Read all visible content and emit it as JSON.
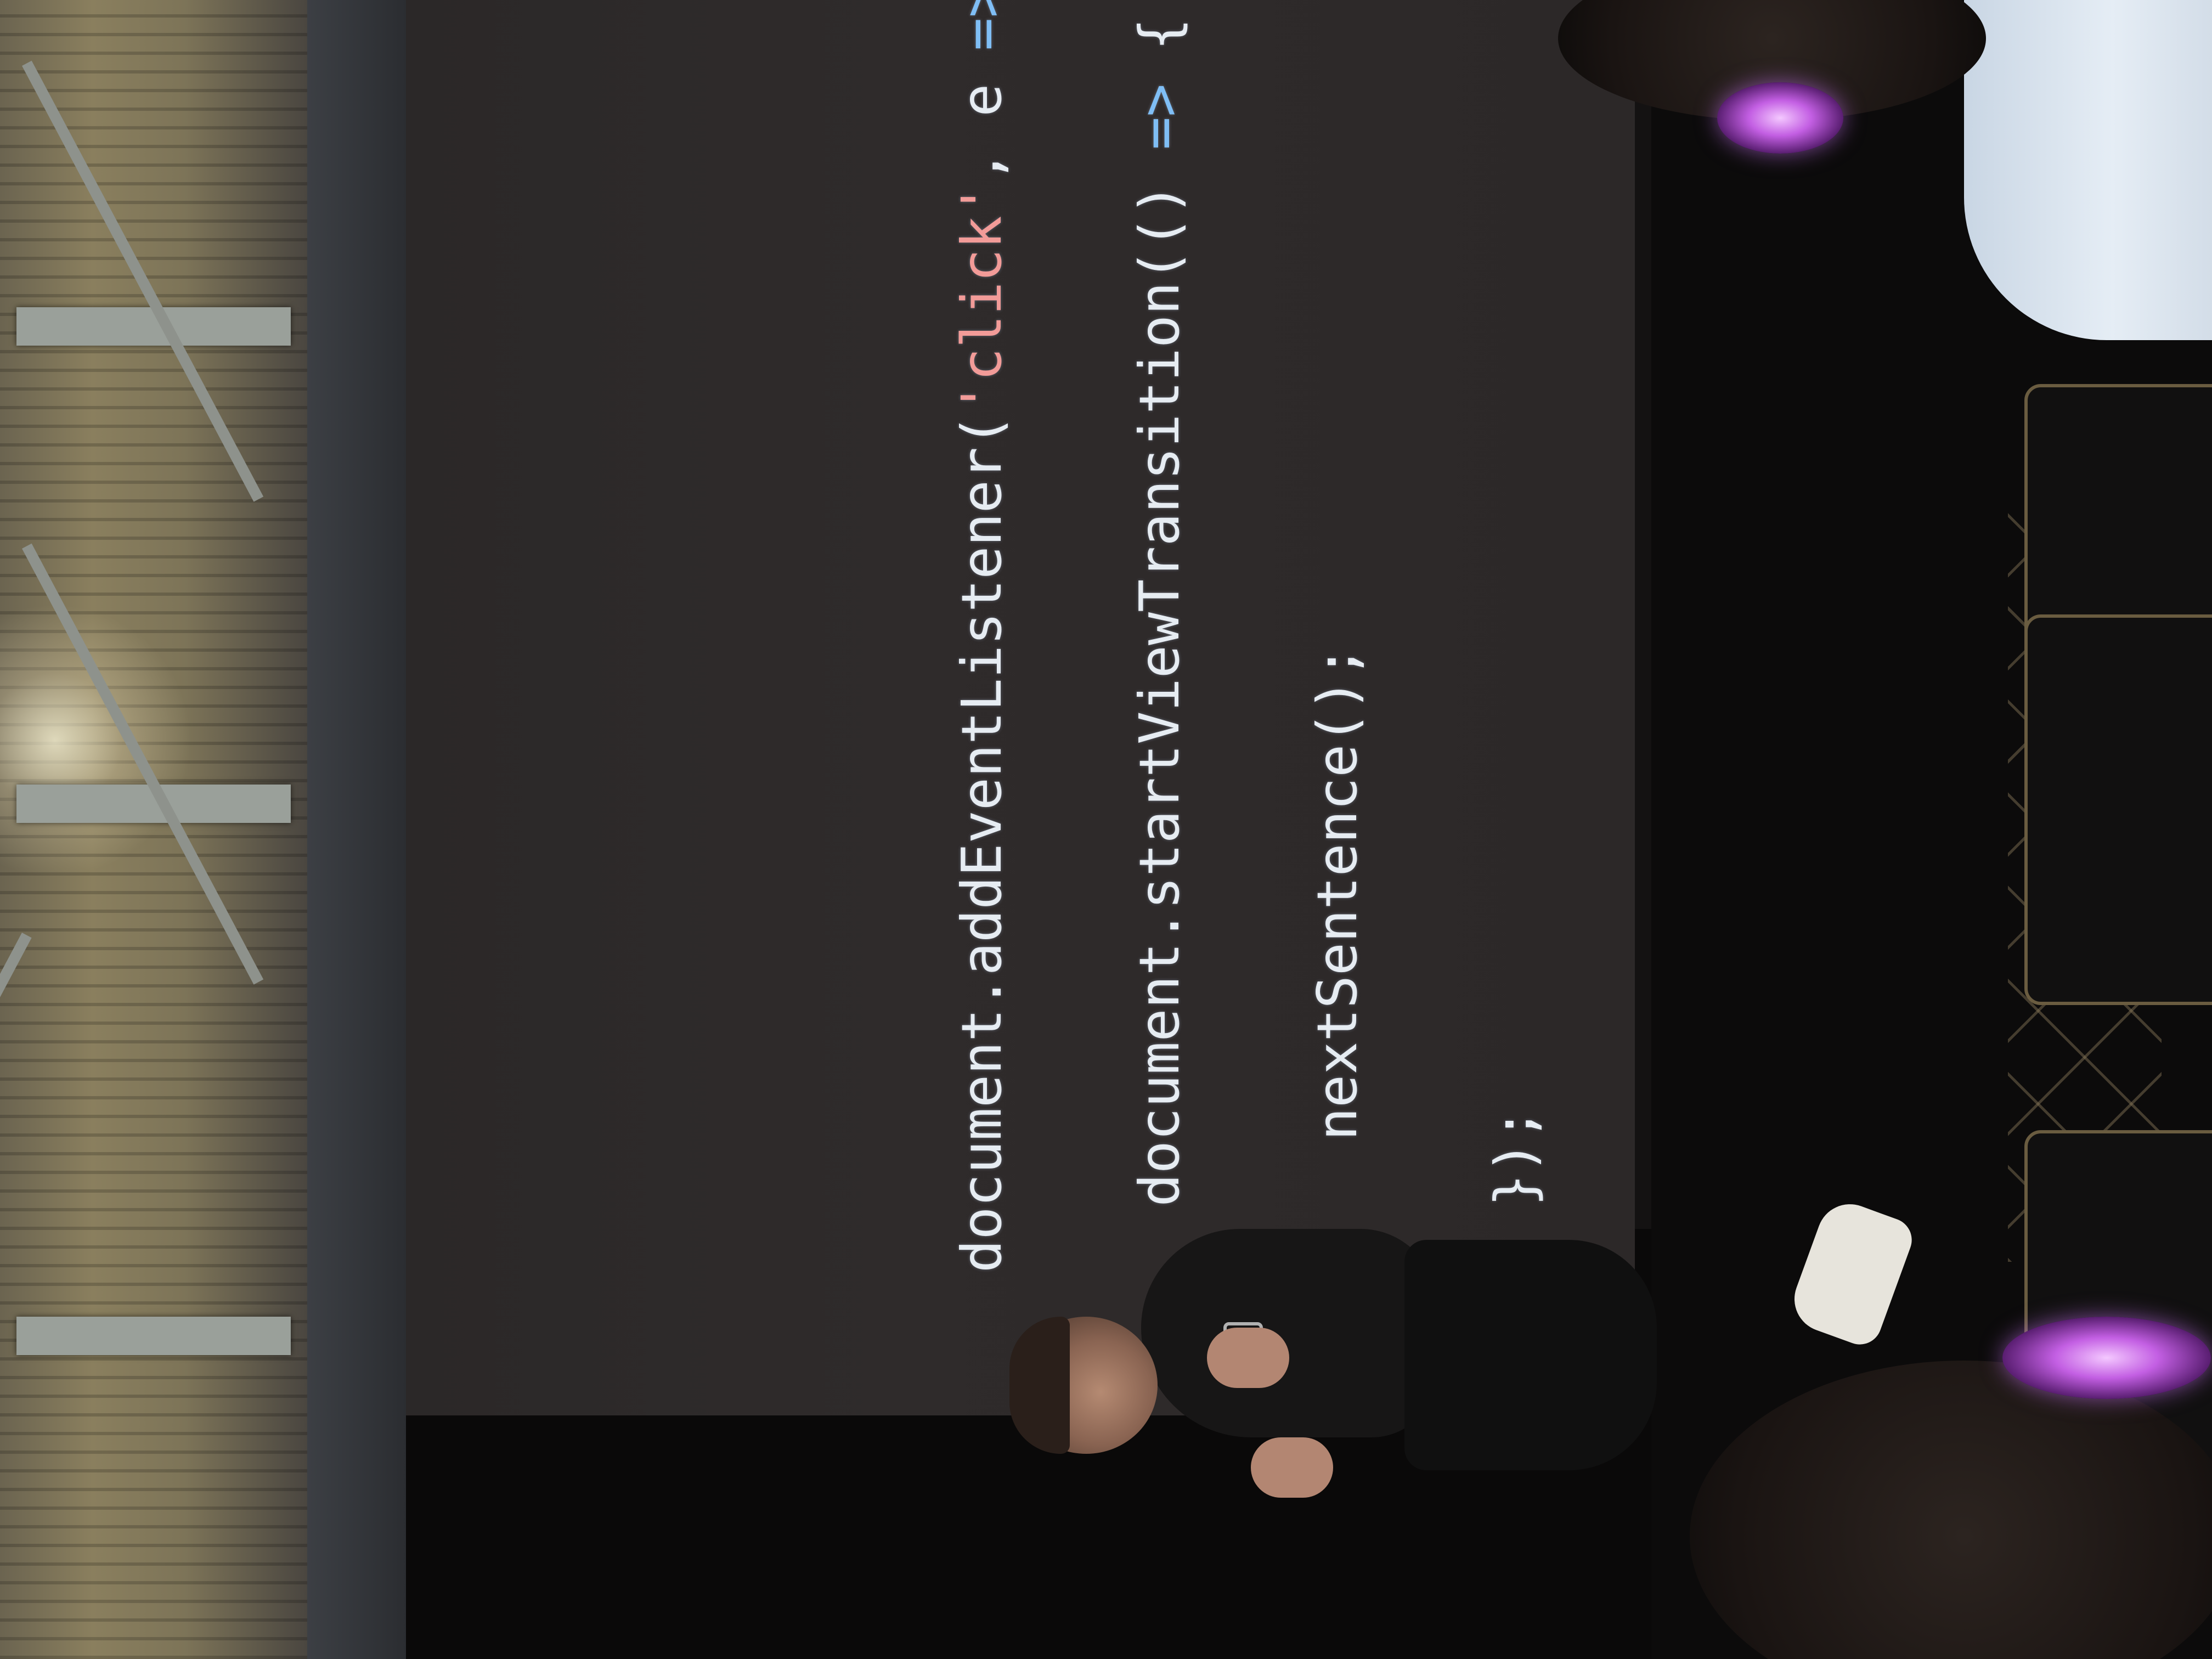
{
  "slide": {
    "code_lines": [
      [
        "document.addEventListener(",
        "'click'",
        ", e ",
        "=>",
        " {"
      ],
      [
        "  document.startViewTransition(() ",
        "=>",
        " {"
      ],
      [
        "    nextSentence();",
        "",
        "",
        "",
        ""
      ],
      [
        "  });",
        "",
        "",
        "",
        ""
      ],
      [
        "})",
        "",
        "",
        "",
        ""
      ]
    ]
  },
  "colors": {
    "screen_background": "#2d2929",
    "code_text": "#e6ecf2",
    "code_string": "#f29b98",
    "code_operator": "#7fbef5",
    "headphone_glow": "#c35fe3"
  },
  "scene": {
    "subject": "speaker-on-stage",
    "icons": [
      "headphone-icon"
    ]
  }
}
